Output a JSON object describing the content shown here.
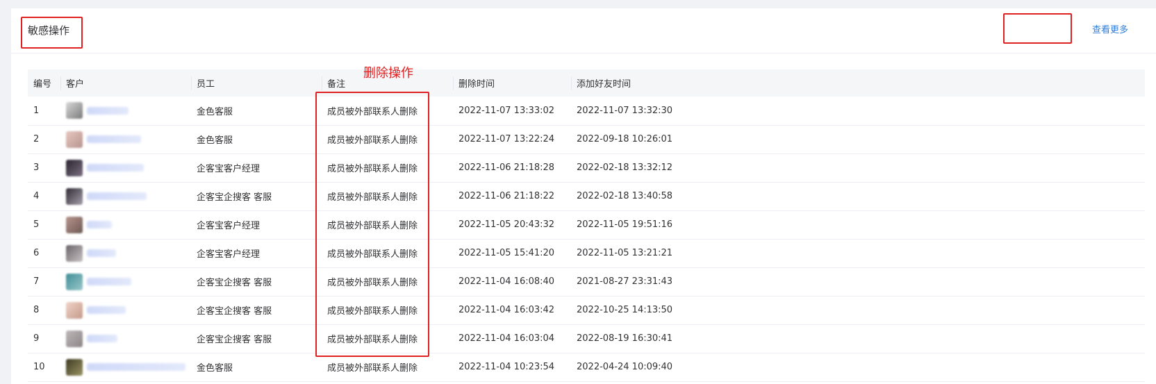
{
  "header": {
    "title": "敏感操作",
    "view_more": "查看更多"
  },
  "annotation": {
    "label": "删除操作"
  },
  "table": {
    "columns": [
      "编号",
      "客户",
      "员工",
      "备注",
      "删除时间",
      "添加好友时间"
    ],
    "rows": [
      {
        "no": "1",
        "employee": "金色客服",
        "remark": "成员被外部联系人删除",
        "deleted_at": "2022-11-07 13:33:02",
        "added_at": "2022-11-07 13:32:30"
      },
      {
        "no": "2",
        "employee": "金色客服",
        "remark": "成员被外部联系人删除",
        "deleted_at": "2022-11-07 13:22:24",
        "added_at": "2022-09-18 10:26:01"
      },
      {
        "no": "3",
        "employee": "企客宝客户经理",
        "remark": "成员被外部联系人删除",
        "deleted_at": "2022-11-06 21:18:28",
        "added_at": "2022-02-18 13:32:12"
      },
      {
        "no": "4",
        "employee": "企客宝企搜客 客服",
        "remark": "成员被外部联系人删除",
        "deleted_at": "2022-11-06 21:18:22",
        "added_at": "2022-02-18 13:40:58"
      },
      {
        "no": "5",
        "employee": "企客宝客户经理",
        "remark": "成员被外部联系人删除",
        "deleted_at": "2022-11-05 20:43:32",
        "added_at": "2022-11-05 19:51:16"
      },
      {
        "no": "6",
        "employee": "企客宝客户经理",
        "remark": "成员被外部联系人删除",
        "deleted_at": "2022-11-05 15:41:20",
        "added_at": "2022-11-05 13:21:21"
      },
      {
        "no": "7",
        "employee": "企客宝企搜客 客服",
        "remark": "成员被外部联系人删除",
        "deleted_at": "2022-11-04 16:08:40",
        "added_at": "2021-08-27 23:31:43"
      },
      {
        "no": "8",
        "employee": "企客宝企搜客 客服",
        "remark": "成员被外部联系人删除",
        "deleted_at": "2022-11-04 16:03:42",
        "added_at": "2022-10-25 14:13:50"
      },
      {
        "no": "9",
        "employee": "企客宝企搜客 客服",
        "remark": "成员被外部联系人删除",
        "deleted_at": "2022-11-04 16:03:04",
        "added_at": "2022-08-19 16:30:41"
      },
      {
        "no": "10",
        "employee": "金色客服",
        "remark": "成员被外部联系人删除",
        "deleted_at": "2022-11-04 10:23:54",
        "added_at": "2022-04-24 10:09:40"
      }
    ]
  }
}
